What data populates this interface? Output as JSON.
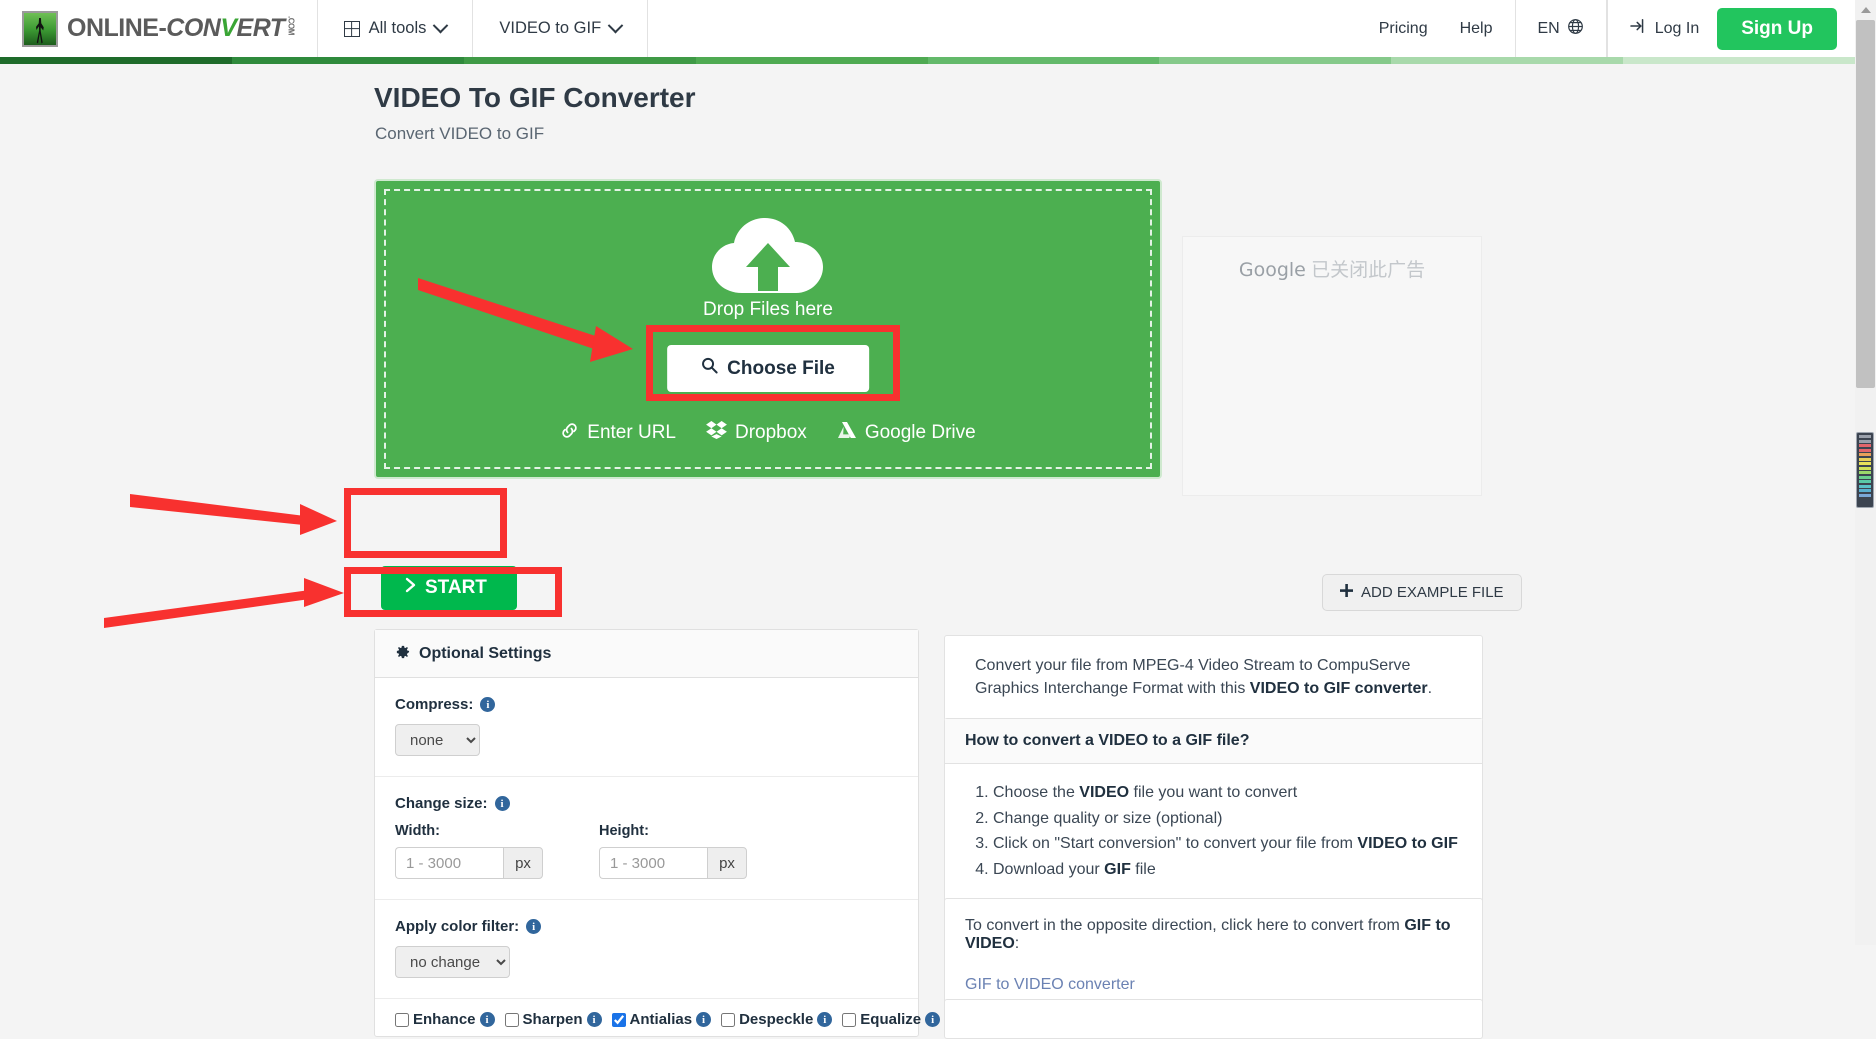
{
  "header": {
    "logo": {
      "part1": "ONLINE-",
      "part2": "CON",
      "part3": "V",
      "part4": "ERT",
      "suffix": ".COM"
    },
    "all_tools": "All tools",
    "current_tool": "VIDEO to GIF",
    "pricing": "Pricing",
    "help": "Help",
    "language": "EN",
    "login": "Log In",
    "signup": "Sign Up"
  },
  "accent_colors": [
    "#1e6b2a",
    "#2f8a3c",
    "#3f9a46",
    "#4faa52",
    "#63b96a",
    "#85c98a",
    "#a8d9ab",
    "#c9e7ca"
  ],
  "page": {
    "title": "VIDEO To GIF Converter",
    "subtitle": "Convert VIDEO to GIF"
  },
  "dropzone": {
    "drop_label": "Drop Files here",
    "choose_file": "Choose File",
    "sources": [
      {
        "label": "Enter URL",
        "icon": "link-icon"
      },
      {
        "label": "Dropbox",
        "icon": "dropbox-icon"
      },
      {
        "label": "Google Drive",
        "icon": "google-drive-icon"
      }
    ]
  },
  "ad": {
    "brand": "Google",
    "message": "已关闭此广告"
  },
  "actions": {
    "start": "START",
    "add_example": "ADD EXAMPLE FILE"
  },
  "settings": {
    "header": "Optional Settings",
    "compress": {
      "label": "Compress:",
      "value": "none",
      "options": [
        "none"
      ]
    },
    "change_size": {
      "label": "Change size:",
      "width_label": "Width:",
      "height_label": "Height:",
      "width_placeholder": "1 - 3000",
      "height_placeholder": "1 - 3000",
      "width_value": "",
      "height_value": "",
      "unit": "px"
    },
    "color_filter": {
      "label": "Apply color filter:",
      "value": "no change",
      "options": [
        "no change"
      ]
    },
    "toggles": [
      {
        "label": "Enhance",
        "checked": false
      },
      {
        "label": "Sharpen",
        "checked": false
      },
      {
        "label": "Antialias",
        "checked": true
      },
      {
        "label": "Despeckle",
        "checked": false
      },
      {
        "label": "Equalize",
        "checked": false
      }
    ]
  },
  "info": {
    "description_pre": "Convert your file from MPEG-4 Video Stream to CompuServe Graphics Interchange Format with this ",
    "description_bold": "VIDEO to GIF converter",
    "description_post": ".",
    "howto_title": "How to convert a VIDEO to a GIF file?",
    "howto_steps": [
      {
        "pre": "Choose the ",
        "bold": "VIDEO",
        "post": " file you want to convert"
      },
      {
        "pre": "Change quality or size (optional)",
        "bold": "",
        "post": ""
      },
      {
        "pre": "Click on \"Start conversion\" to convert your file from ",
        "bold": "VIDEO to GIF",
        "post": ""
      },
      {
        "pre": "Download your ",
        "bold": "GIF",
        "post": " file"
      }
    ],
    "opposite_pre": "To convert in the opposite direction, click here to convert from ",
    "opposite_bold": "GIF to VIDEO",
    "opposite_post": ":",
    "opposite_link": "GIF to VIDEO converter"
  },
  "annotation_color": "#f8312f"
}
